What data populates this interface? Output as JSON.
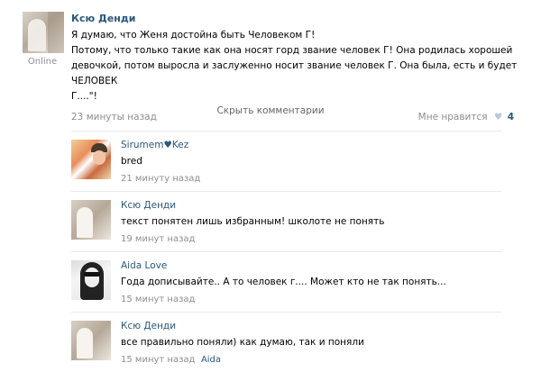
{
  "post": {
    "author": "Ксю Денди",
    "status": "Online",
    "text_lines": [
      "Я думаю, что Женя достойна быть Человеком Г!",
      "Потому, что только такие как она носят горд звание человек Г! Она родилась хорошей",
      "девочкой, потом выросла и заслуженно носит звание человек Г. Она была, есть и будет ЧЕЛОВЕК",
      "Г....\"!"
    ],
    "time": "23 минуты назад",
    "likes_label": "Мне нравится",
    "likes_count": "4"
  },
  "hide_comments_label": "Скрыть комментарии",
  "comments": [
    {
      "author": "Sirumem♥Kez",
      "text": "bred",
      "time": "21 минуту назад",
      "reply_to": ""
    },
    {
      "author": "Ксю Денди",
      "text": "текст понятен лишь избранным! школоте не понять",
      "time": "19 минут назад",
      "reply_to": ""
    },
    {
      "author": "Aida Love",
      "text": "Года дописывайте.. А то человек г.... Может кто не так понять...",
      "time": "15 минут назад",
      "reply_to": ""
    },
    {
      "author": "Ксю Денди",
      "text": "все правильно поняли) как думаю, так и поняли",
      "time": "15 минут назад",
      "reply_to": "Aida"
    }
  ],
  "colors": {
    "link": "#2b587a",
    "meta": "#8e8e8e",
    "divider": "#e7eaed"
  }
}
